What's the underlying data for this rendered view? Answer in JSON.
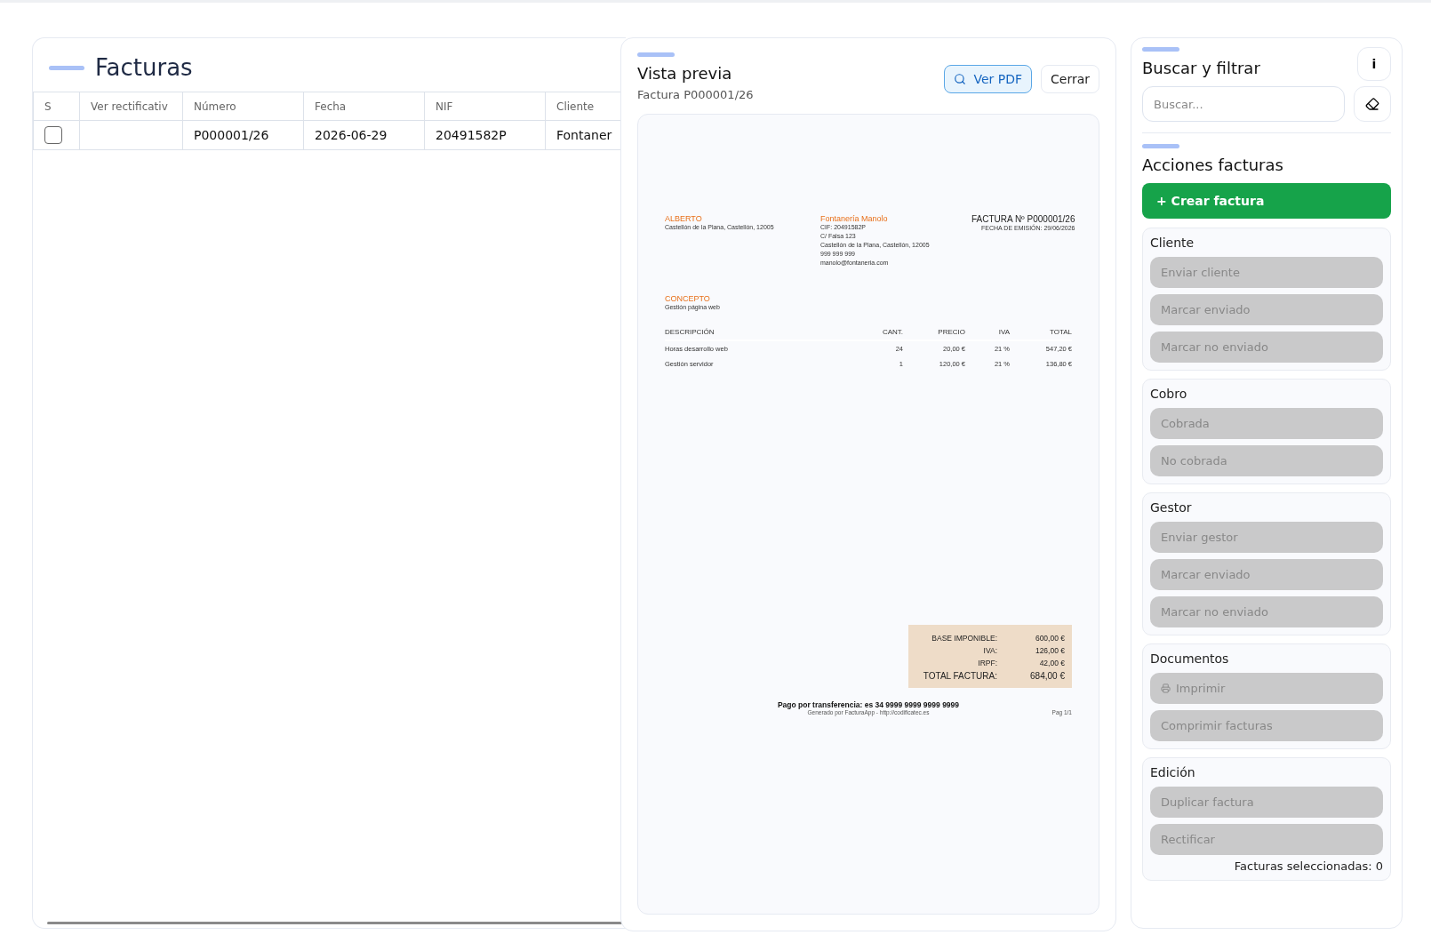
{
  "invoices": {
    "title": "Facturas",
    "columns": [
      "S",
      "Ver rectificativ",
      "Número",
      "Fecha",
      "NIF",
      "Cliente"
    ],
    "rows": [
      {
        "checked": false,
        "cells": [
          "",
          "",
          "P000001/26",
          "2026-06-29",
          "20491582P",
          "Fontaner"
        ]
      }
    ]
  },
  "preview": {
    "title": "Vista previa",
    "subtitle": "Factura P000001/26",
    "buttons": [
      {
        "label": "Ver PDF",
        "kind": "primary"
      },
      {
        "label": "Cerrar",
        "kind": "plain"
      }
    ],
    "document": {
      "client_name": "ALBERTO",
      "client_address": "Castellón de la Plana, Castellón, 12005",
      "issuer_name": "Fontanería Manolo",
      "issuer_lines": [
        "CIF: 20491582P",
        "C/ Falsa 123",
        "Castellón de la Plana, Castellón, 12005",
        "999 999 999",
        "manolo@fontaneria.com"
      ],
      "number": "FACTURA Nº P000001/26",
      "date": "FECHA DE EMISIÓN: 29/06/2026",
      "concept_label": "CONCEPTO",
      "concept": "Gestión página web",
      "columns": [
        "DESCRIPCIÓN",
        "CANT.",
        "PRECIO",
        "IVA",
        "TOTAL"
      ],
      "lines": [
        [
          "Horas desarrollo web",
          "24",
          "20,00 €",
          "21 %",
          "547,20 €"
        ],
        [
          "Gestión servidor",
          "1",
          "120,00 €",
          "21 %",
          "136,80 €"
        ]
      ],
      "totals": [
        {
          "label": "BASE IMPONIBLE:",
          "value": "600,00 €",
          "kind": "sub"
        },
        {
          "label": "IVA:",
          "value": "126,00 €",
          "kind": "sub"
        },
        {
          "label": "IRPF:",
          "value": "42,00 €",
          "kind": "sub"
        },
        {
          "label": "TOTAL FACTURA:",
          "value": "684,00 €",
          "kind": "grand"
        }
      ],
      "payment": "Pago por transferencia: es 34 9999 9999 9999 9999",
      "generated": "Generado por FacturaApp - http://codificatec.es",
      "page": "Pag 1/1"
    }
  },
  "sidebar": {
    "search_title": "Buscar y filtrar",
    "info_button": "i",
    "search": {
      "placeholder": "Buscar..."
    },
    "actions_title": "Acciones facturas",
    "create_button": "+ Crear factura",
    "groups": [
      {
        "title": "Cliente",
        "buttons": [
          {
            "label": "Enviar cliente",
            "disabled": true
          },
          {
            "label": "Marcar enviado",
            "disabled": true
          },
          {
            "label": "Marcar no enviado",
            "disabled": true
          }
        ]
      },
      {
        "title": "Cobro",
        "buttons": [
          {
            "label": "Cobrada",
            "disabled": true
          },
          {
            "label": "No cobrada",
            "disabled": true
          }
        ]
      },
      {
        "title": "Gestor",
        "buttons": [
          {
            "label": "Enviar gestor",
            "disabled": true
          },
          {
            "label": "Marcar enviado",
            "disabled": true
          },
          {
            "label": "Marcar no enviado",
            "disabled": true
          }
        ]
      },
      {
        "title": "Documentos",
        "buttons": [
          {
            "label": "Imprimir",
            "disabled": true,
            "kind": "print"
          },
          {
            "label": "Comprimir facturas",
            "disabled": true
          }
        ]
      },
      {
        "title": "Edición",
        "buttons": [
          {
            "label": "Duplicar factura",
            "disabled": true
          },
          {
            "label": "Rectificar",
            "disabled": true
          }
        ]
      }
    ],
    "selected_count": "Facturas seleccionadas: 0"
  }
}
